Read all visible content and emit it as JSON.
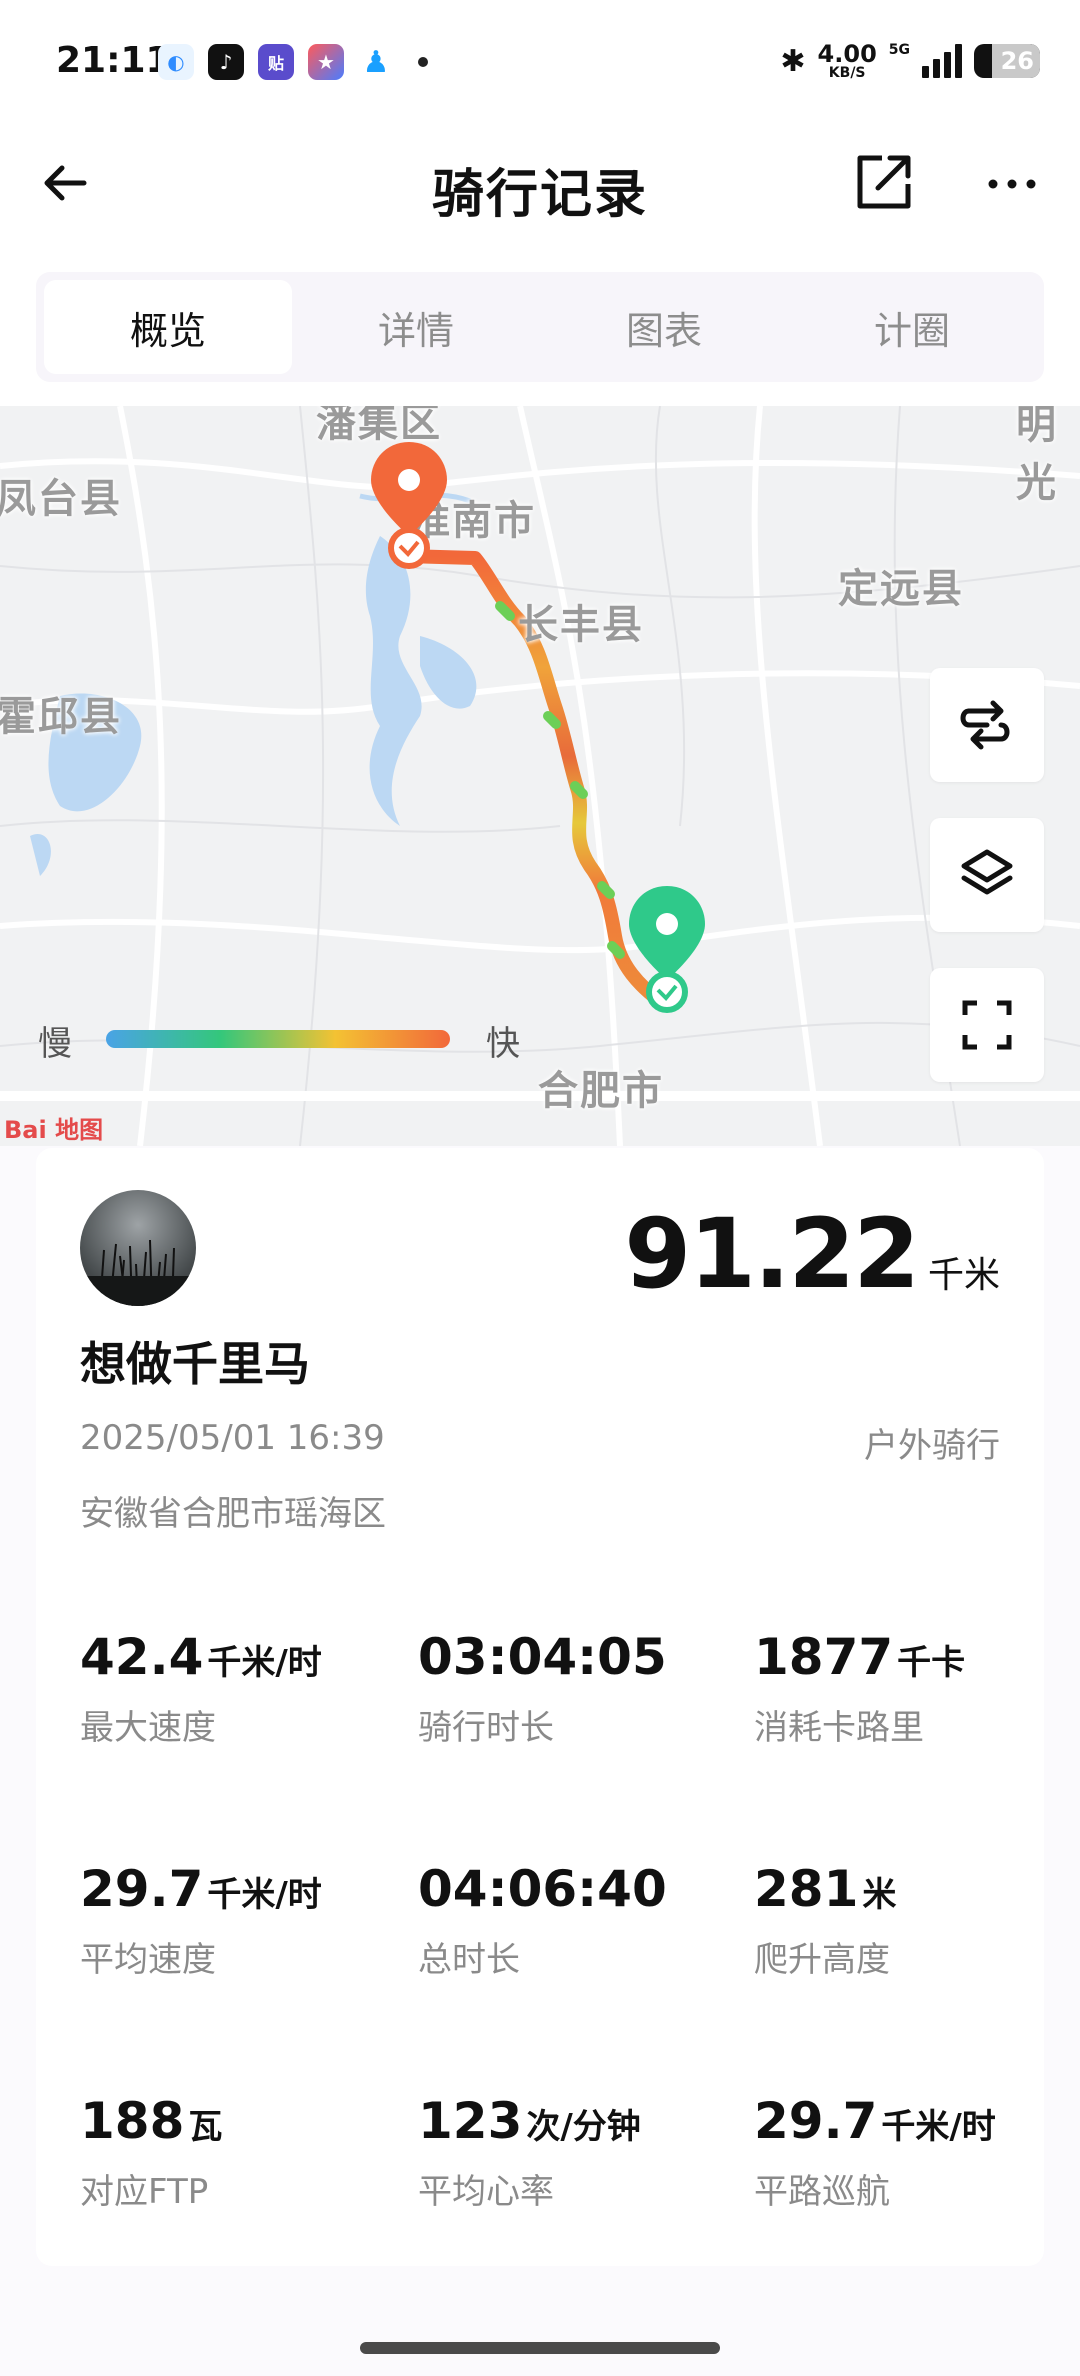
{
  "status_bar": {
    "time": "21:11",
    "net_speed": "4.00",
    "net_unit": "KB/S",
    "network_type": "5G",
    "battery": "26"
  },
  "header": {
    "title": "骑行记录"
  },
  "tabs": [
    {
      "label": "概览",
      "active": true
    },
    {
      "label": "详情",
      "active": false
    },
    {
      "label": "图表",
      "active": false
    },
    {
      "label": "计圈",
      "active": false
    }
  ],
  "map": {
    "labels": {
      "panji": "潘集区",
      "huainan": "淮南市",
      "changfeng": "长丰县",
      "dingyuan": "定远县",
      "fengtai": "凤台县",
      "huoqiu": "霍邱县",
      "hefei": "合肥市",
      "ming": "明光"
    },
    "legend": {
      "slow": "慢",
      "fast": "快"
    },
    "provider": "Bai 地图",
    "start_color": "#f2683a",
    "end_color": "#2fc98a"
  },
  "summary": {
    "distance_value": "91.22",
    "distance_unit": "千米",
    "username": "想做千里马",
    "datetime": "2025/05/01 16:39",
    "activity_type": "户外骑行",
    "location": "安徽省合肥市瑶海区"
  },
  "stats": [
    {
      "value": "42.4",
      "unit": "千米/时",
      "label": "最大速度"
    },
    {
      "value": "03:04:05",
      "unit": "",
      "label": "骑行时长"
    },
    {
      "value": "1877",
      "unit": "千卡",
      "label": "消耗卡路里"
    },
    {
      "value": "29.7",
      "unit": "千米/时",
      "label": "平均速度"
    },
    {
      "value": "04:06:40",
      "unit": "",
      "label": "总时长"
    },
    {
      "value": "281",
      "unit": "米",
      "label": "爬升高度"
    },
    {
      "value": "188",
      "unit": "瓦",
      "label": "对应FTP"
    },
    {
      "value": "123",
      "unit": "次/分钟",
      "label": "平均心率"
    },
    {
      "value": "29.7",
      "unit": "千米/时",
      "label": "平路巡航"
    }
  ]
}
